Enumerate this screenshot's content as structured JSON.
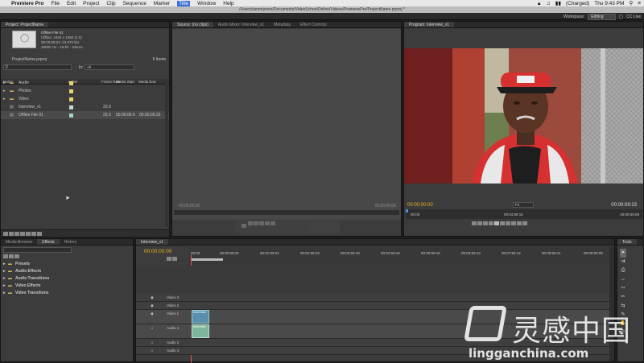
{
  "menubar": {
    "apple": "",
    "app": "Premiere Pro",
    "items": [
      "File",
      "Edit",
      "Project",
      "Clip",
      "Sequence",
      "Marker",
      "Title",
      "Window",
      "Help"
    ],
    "battery": "(Charged)",
    "clock": "Thu 9:43 PM"
  },
  "titlebar": {
    "path": "/Users/sammjones/Documents/VideoSchoolOnline/Videos/PremierePro/ProjectName.prproj *"
  },
  "workspace": {
    "label": "Workspace:",
    "value": "Editing",
    "cclive": "CC Live"
  },
  "project": {
    "tab": "Project: ProjectName",
    "clip_name": "Offline File 01",
    "clip_info1": "Offline, 1920 x 1080 (1.0)",
    "clip_info2": "00:00:09:23, 23.976 fps",
    "clip_info3": "48000 Hz - 16-bit - Stereo",
    "project_file": "ProjectName.prproj",
    "items_count": "5 Items",
    "in_label": "In:",
    "in_value": "All",
    "columns": {
      "name": "Name",
      "label": "Label",
      "fps": "Frame Rate",
      "mstart": "Media Start",
      "mend": "Media End"
    },
    "rows": [
      {
        "name": "Audio",
        "color": "#e8d56a",
        "fps": "",
        "mstart": "",
        "mend": "",
        "folder": true
      },
      {
        "name": "Photos",
        "color": "#e8d56a",
        "fps": "",
        "mstart": "",
        "mend": "",
        "folder": true
      },
      {
        "name": "Video",
        "color": "#e8d56a",
        "fps": "",
        "mstart": "",
        "mend": "",
        "folder": true
      },
      {
        "name": "Interview_v1",
        "color": "#bcd9d9",
        "fps": "23.9",
        "mstart": "",
        "mend": "",
        "folder": false
      },
      {
        "name": "Offline File 01",
        "color": "#9fd4c8",
        "fps": "23.9",
        "mstart": "00:00:00:0",
        "mend": "00:00:09:23",
        "folder": false
      }
    ]
  },
  "source": {
    "tabs": [
      "Source: (no clips)",
      "Audio Mixer: Interview_v1",
      "Metadata",
      "Effect Controls"
    ],
    "tc_left": "00;00;00;00",
    "tc_right": "00;00;00;00"
  },
  "program": {
    "tab": "Program: Interview_v1",
    "tc_left": "00:00:00:00",
    "fit": "Fit",
    "tc_right": "00:00:09:23",
    "ruler_left": "00:00",
    "ruler_mid": "00:04:59:16",
    "ruler_right": "00:09:59:09"
  },
  "effects": {
    "tabs": [
      "Media Browser",
      "Effects",
      "History"
    ],
    "items": [
      "Presets",
      "Audio Effects",
      "Audio Transitions",
      "Video Effects",
      "Video Transitions"
    ]
  },
  "timeline": {
    "tab": "Interview_v1",
    "timecode": "00:00:00:00",
    "ticks": [
      "00:00",
      "00:00:59:22",
      "00:01:59:21",
      "00:02:59:19",
      "00:03:59:18",
      "00:04:59:16",
      "00:05:59:15",
      "00:06:59:13",
      "00:07:59:12",
      "00:08:59:11",
      "00:09:59:09"
    ],
    "tracks": [
      "Video 3",
      "Video 2",
      "Video 1",
      "Audio 1",
      "Audio 2",
      "Audio 3"
    ],
    "clip_label": "Interview"
  },
  "tools": {
    "tab": "Tools"
  },
  "watermark": {
    "name": "灵感中国",
    "url": "lingganchina.com"
  },
  "colors": {
    "accent_gold": "#e8b624",
    "playhead": "#e85050",
    "clip_video": "#5b8fb0",
    "clip_audio": "#7fb59a",
    "cap_red": "#d63030"
  }
}
